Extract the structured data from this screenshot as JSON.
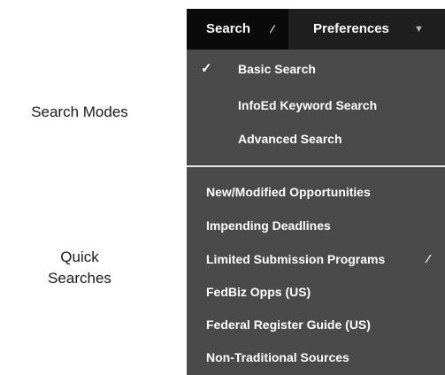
{
  "annotations": {
    "search_modes": "Search Modes",
    "quick_searches_line1": "Quick",
    "quick_searches_line2": "Searches"
  },
  "menubar": {
    "search_tab": "Search",
    "preferences_tab": "Preferences"
  },
  "search_modes": {
    "items": [
      {
        "label": "Basic Search",
        "checked": true
      },
      {
        "label": "InfoEd Keyword Search",
        "checked": false
      },
      {
        "label": "Advanced Search",
        "checked": false
      }
    ],
    "check_glyph": "✓"
  },
  "quick_searches": {
    "items": [
      {
        "label": "New/Modified Opportunities"
      },
      {
        "label": "Impending Deadlines"
      },
      {
        "label": "Limited Submission Programs",
        "has_submenu": true
      },
      {
        "label": "FedBiz Opps (US)"
      },
      {
        "label": "Federal Register Guide (US)"
      },
      {
        "label": "Non-Traditional Sources"
      }
    ]
  },
  "colors": {
    "menubar_bg": "#1f1f1f",
    "active_tab_bg": "#0a0a0a",
    "dropdown_bg": "#4a4a4a",
    "text": "#ffffff",
    "divider": "#e8e8e8"
  }
}
